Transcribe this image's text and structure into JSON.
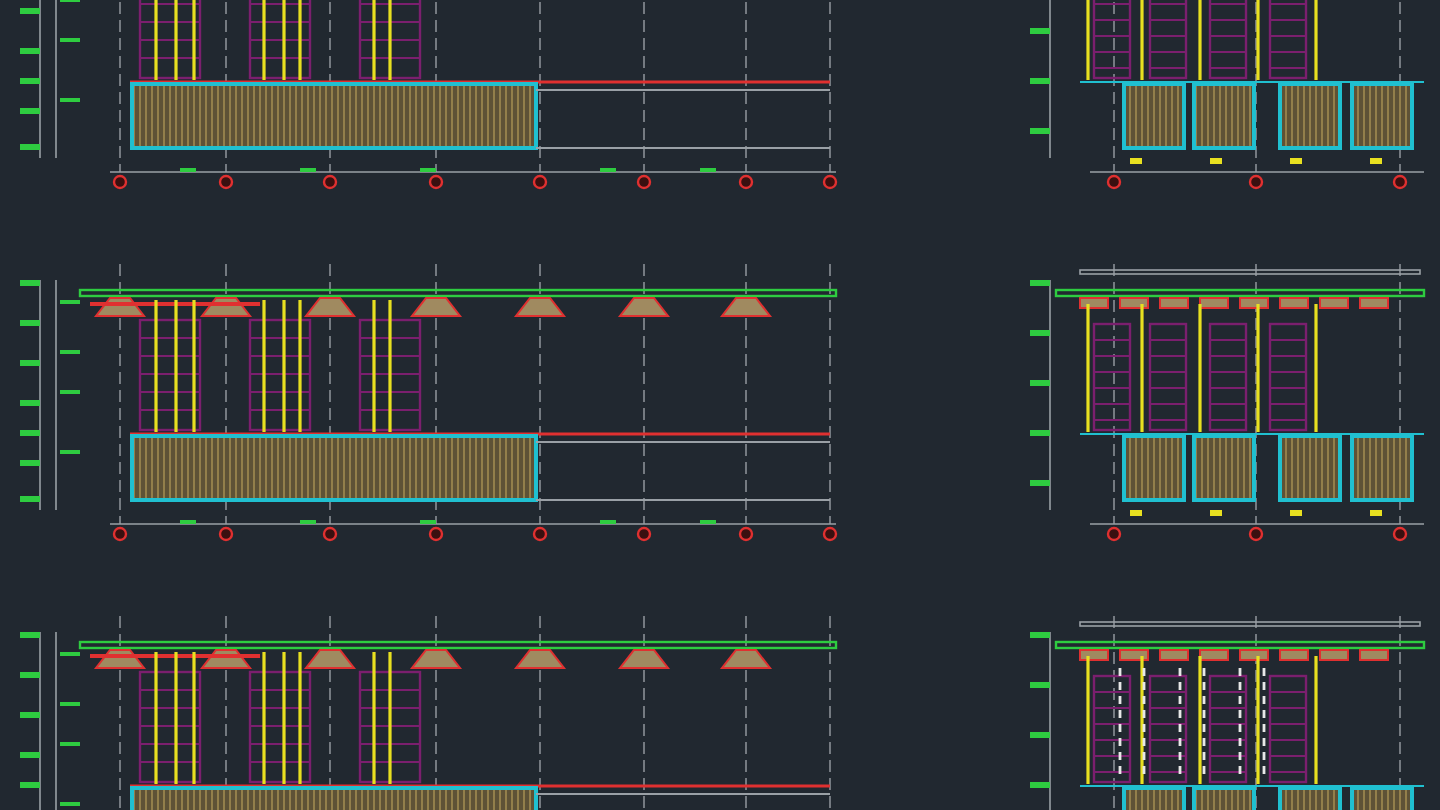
{
  "rows": [
    {
      "sections": [
        {
          "kind": "long"
        },
        {
          "kind": "cross",
          "pipes": false
        }
      ]
    },
    {
      "sections": [
        {
          "kind": "long"
        },
        {
          "kind": "cross",
          "pipes": false
        }
      ]
    },
    {
      "sections": [
        {
          "kind": "long"
        },
        {
          "kind": "cross",
          "pipes": true
        }
      ]
    }
  ]
}
